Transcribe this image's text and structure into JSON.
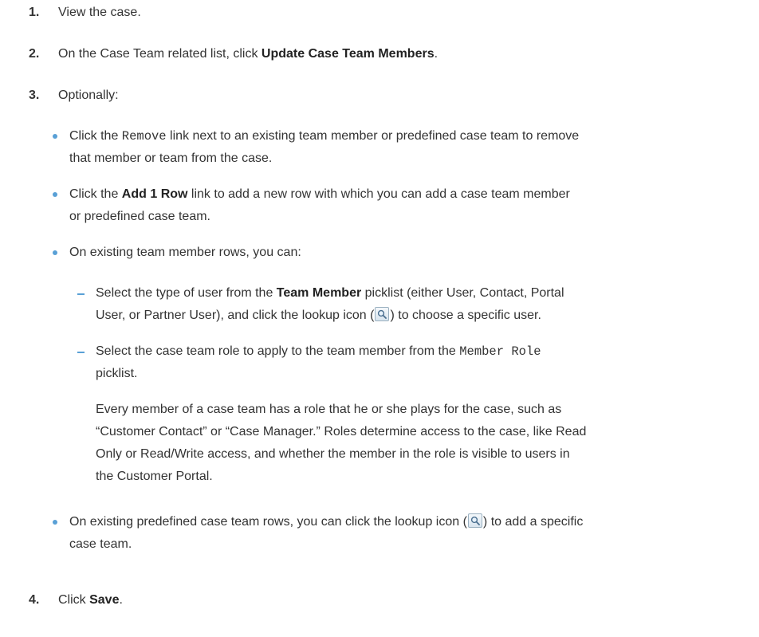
{
  "steps": [
    {
      "number": "1.",
      "text": "View the case."
    },
    {
      "number": "2.",
      "pre": "On the Case Team related list, click ",
      "bold": "Update Case Team Members",
      "post": "."
    },
    {
      "number": "3.",
      "text": "Optionally:"
    },
    {
      "number": "4.",
      "pre": "Click ",
      "bold": "Save",
      "post": "."
    }
  ],
  "bullets": {
    "remove": {
      "pre": "Click the ",
      "code": "Remove",
      "post": " link next to an existing team member or predefined case team to remove",
      "line2": "that member or team from the case."
    },
    "add_row": {
      "pre": "Click the ",
      "bold": "Add 1 Row",
      "post": " link to add a new row with which you can add a case team member",
      "line2": "or predefined case team."
    },
    "existing_members": {
      "text": "On existing team member rows, you can:"
    },
    "predefined": {
      "pre": "On existing predefined case team rows, you can click the lookup icon (",
      "post": ") to add a specific",
      "line2": "case team."
    }
  },
  "subitems": {
    "team_member": {
      "pre": "Select the type of user from the ",
      "bold": "Team Member",
      "post": " picklist (either User, Contact, Portal",
      "line2_pre": "User, or Partner User), and click the lookup icon (",
      "line2_post": ") to choose a specific user."
    },
    "member_role": {
      "pre": "Select the case team role to apply to the team member from the ",
      "code": "Member Role",
      "line2": "picklist."
    }
  },
  "role_paragraph": [
    "Every member of a case team has a role that he or she plays for the case, such as",
    "“Customer Contact” or “Case Manager.” Roles determine access to the case, like Read",
    "Only or Read/Write access, and whether the member in the role is visible to users in",
    "the Customer Portal."
  ],
  "icons": {
    "lookup": "magnifier-lookup-icon",
    "bullet_color": "#59a0d6"
  }
}
